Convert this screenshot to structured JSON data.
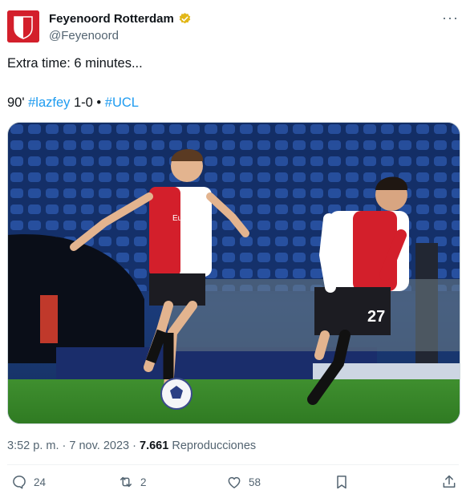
{
  "tweet": {
    "display_name": "Feyenoord Rotterdam",
    "handle": "@Feyenoord",
    "more_icon": "more-dots-icon",
    "line1": "Extra time: 6 minutes...",
    "line2": {
      "prefix": "90'",
      "hashtag1": "#lazfey",
      "score": "1-0 •",
      "hashtag2": "#UCL"
    },
    "image": {
      "shirt_sponsor": "Euro Parcs",
      "player_number": "27"
    },
    "time": "3:52 p. m.",
    "sep": "·",
    "date": "7 nov. 2023",
    "views_count": "7.661",
    "views_label": "Reproducciones"
  },
  "actions": {
    "replies": "24",
    "retweets": "2",
    "likes": "58"
  },
  "colors": {
    "brand_red": "#d31f2b",
    "link_blue": "#1d9bf0",
    "verified_gold": "#e2b719",
    "muted_text": "#536471"
  }
}
